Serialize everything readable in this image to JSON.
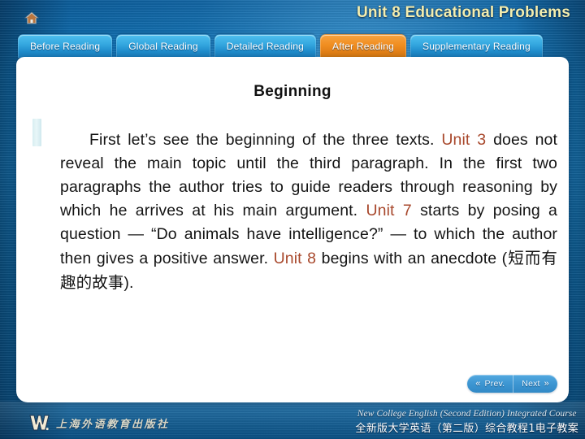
{
  "header": {
    "home_icon": "home-icon",
    "title": "Unit 8 Educational Problems",
    "title_color": "#f3eeb0"
  },
  "tabs": [
    {
      "label": "Before Reading",
      "active": false
    },
    {
      "label": "Global Reading",
      "active": false
    },
    {
      "label": "Detailed Reading",
      "active": false
    },
    {
      "label": "After Reading",
      "active": true
    },
    {
      "label": "Supplementary Reading",
      "active": false
    }
  ],
  "tab_active_color": "#ef8f21",
  "tab_inactive_color": "#2f9ddb",
  "content": {
    "title": "Beginning",
    "highlight_color": "#a8482c",
    "paragraph": {
      "seg1": "First let’s see the beginning of the three texts. ",
      "hl1": "Unit 3",
      "seg2": " does not reveal the main topic until the third paragraph. In the first two paragraphs the author tries to guide readers through reasoning by which he arrives at his main argument. ",
      "hl2": "Unit 7",
      "seg3": " starts by posing a question — “Do animals have intelligence?” — to which the author then gives a positive answer. ",
      "hl3": "Unit 8",
      "seg4": " begins with an anecdote (",
      "seg4_cn": "短而有趣的故事",
      "seg5": ")."
    }
  },
  "navigation": {
    "prev_label": "Prev.",
    "next_label": "Next",
    "prev_icon": "chevron-double-left-icon",
    "next_icon": "chevron-double-right-icon"
  },
  "footer": {
    "publisher_logo": "w-logo",
    "publisher_cn": "上海外语教育出版社",
    "course_en": "New College English (Second Edition) Integrated Course",
    "course_cn": "全新版大学英语（第二版）综合教程1电子教案"
  }
}
